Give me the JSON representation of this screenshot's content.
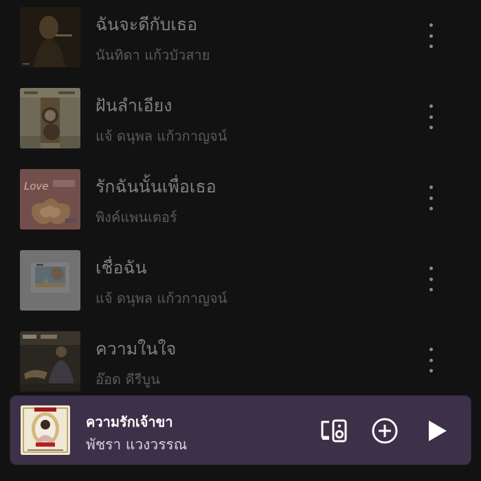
{
  "songs": [
    {
      "title": "ฉันจะดีกับเธอ",
      "artist": "นันทิดา แก้วบัวสาย",
      "cover_icon": "album-cover"
    },
    {
      "title": "ฝันลำเอียง",
      "artist": "แจ้ ดนุพล แก้วกาญจน์",
      "cover_icon": "album-cover"
    },
    {
      "title": "รักฉันนั้นเพื่อเธอ",
      "artist": "พิงค์แพนเตอร์",
      "cover_icon": "album-cover"
    },
    {
      "title": "เชื่อฉัน",
      "artist": "แจ้ ดนุพล แก้วกาญจน์",
      "cover_icon": "album-cover"
    },
    {
      "title": "ความในใจ",
      "artist": "อ๊อด คีรีบูน",
      "cover_icon": "album-cover"
    }
  ],
  "now_playing": {
    "title": "ความรักเจ้าขา",
    "artist": "พัชรา แวงวรรณ",
    "controls": [
      "devices-icon",
      "add-icon",
      "play-icon"
    ]
  },
  "colors": {
    "background": "#121212",
    "mini_player": "#3d3149",
    "title_text": "#7f7f7f",
    "artist_text": "#5a5a5a"
  }
}
